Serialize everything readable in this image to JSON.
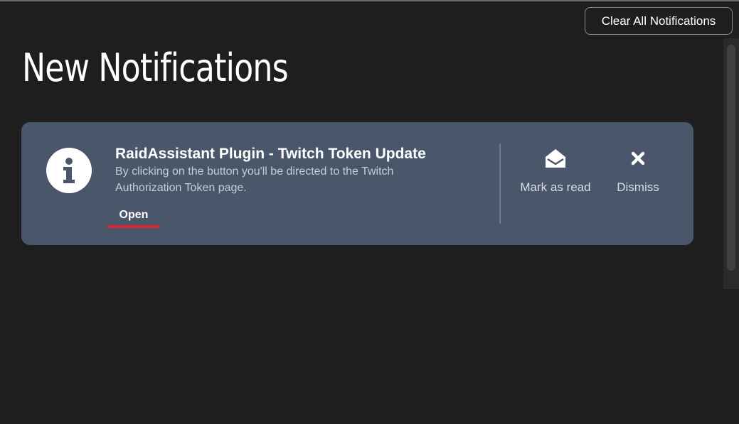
{
  "header": {
    "clear_all_label": "Clear All Notifications",
    "page_title": "New Notifications"
  },
  "notification": {
    "icon": "info-icon",
    "title": "RaidAssistant Plugin - Twitch Token Update",
    "description": "By clicking on the button you'll be directed to the Twitch Authorization Token page.",
    "open_label": "Open",
    "actions": {
      "mark_read": {
        "label": "Mark as read",
        "icon": "envelope-open-icon"
      },
      "dismiss": {
        "label": "Dismiss",
        "icon": "close-icon"
      }
    }
  },
  "colors": {
    "background": "#1e1e1e",
    "card": "#4a566a",
    "accent_underline": "#e0242e",
    "text_primary": "#ffffff",
    "text_secondary": "#c6ccd6"
  }
}
